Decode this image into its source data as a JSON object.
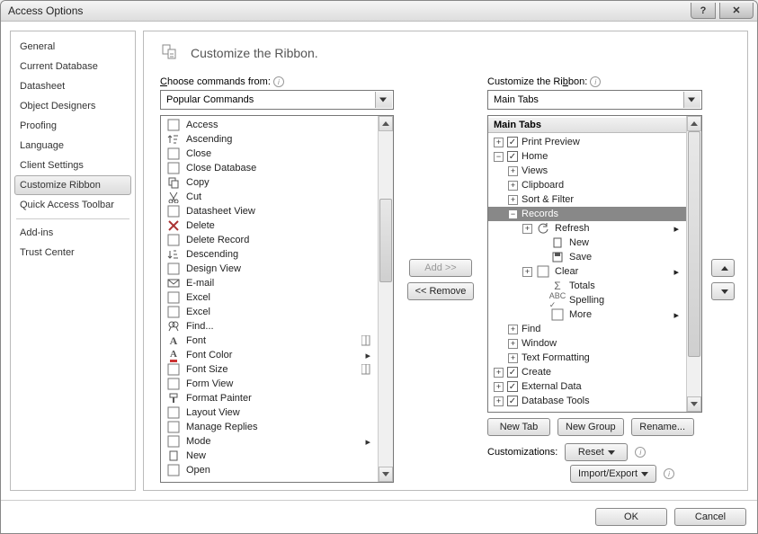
{
  "window": {
    "title": "Access Options"
  },
  "sidebar": {
    "items": [
      "General",
      "Current Database",
      "Datasheet",
      "Object Designers",
      "Proofing",
      "Language",
      "Client Settings",
      "Customize Ribbon",
      "Quick Access Toolbar",
      "Add-ins",
      "Trust Center"
    ],
    "selected_index": 7,
    "separator_before": [
      9
    ]
  },
  "header": {
    "title": "Customize the Ribbon."
  },
  "left": {
    "label_pre": "C",
    "label_rest": "hoose commands from:",
    "combo": "Popular Commands",
    "commands": [
      {
        "name": "Access",
        "icon": "access-icon"
      },
      {
        "name": "Ascending",
        "icon": "sort-asc-icon"
      },
      {
        "name": "Close",
        "icon": "close-icon"
      },
      {
        "name": "Close Database",
        "icon": "close-db-icon"
      },
      {
        "name": "Copy",
        "icon": "copy-icon"
      },
      {
        "name": "Cut",
        "icon": "cut-icon"
      },
      {
        "name": "Datasheet View",
        "icon": "datasheet-icon"
      },
      {
        "name": "Delete",
        "icon": "delete-icon"
      },
      {
        "name": "Delete Record",
        "icon": "delete-record-icon"
      },
      {
        "name": "Descending",
        "icon": "sort-desc-icon"
      },
      {
        "name": "Design View",
        "icon": "design-view-icon"
      },
      {
        "name": "E-mail",
        "icon": "email-icon"
      },
      {
        "name": "Excel",
        "icon": "excel-icon"
      },
      {
        "name": "Excel",
        "icon": "excel-icon"
      },
      {
        "name": "Find...",
        "icon": "find-icon"
      },
      {
        "name": "Font",
        "icon": "font-icon",
        "split": true
      },
      {
        "name": "Font Color",
        "icon": "font-color-icon",
        "submenu": true
      },
      {
        "name": "Font Size",
        "icon": "font-size-icon",
        "split": true
      },
      {
        "name": "Form View",
        "icon": "form-view-icon"
      },
      {
        "name": "Format Painter",
        "icon": "format-painter-icon"
      },
      {
        "name": "Layout View",
        "icon": "layout-view-icon"
      },
      {
        "name": "Manage Replies",
        "icon": "manage-replies-icon"
      },
      {
        "name": "Mode",
        "icon": "mode-icon",
        "submenu": true
      },
      {
        "name": "New",
        "icon": "new-icon"
      },
      {
        "name": "Open",
        "icon": "open-icon"
      }
    ]
  },
  "mid": {
    "add": "Add >>",
    "remove": "<< Remove"
  },
  "right": {
    "label_rest": "Customize the Ri",
    "label_post": "bbon:",
    "combo": "Main Tabs",
    "tree_header": "Main Tabs",
    "tree": [
      {
        "d": 0,
        "exp": "+",
        "chk": true,
        "label": "Print Preview"
      },
      {
        "d": 0,
        "exp": "-",
        "chk": true,
        "label": "Home"
      },
      {
        "d": 1,
        "exp": "+",
        "label": "Views"
      },
      {
        "d": 1,
        "exp": "+",
        "label": "Clipboard"
      },
      {
        "d": 1,
        "exp": "+",
        "label": "Sort & Filter"
      },
      {
        "d": 1,
        "exp": "-",
        "label": "Records",
        "selected": true
      },
      {
        "d": 2,
        "exp": "+",
        "icon": "refresh-icon",
        "label": "Refresh",
        "submenu": true
      },
      {
        "d": 3,
        "icon": "new-icon",
        "label": "New"
      },
      {
        "d": 3,
        "icon": "save-icon",
        "label": "Save"
      },
      {
        "d": 2,
        "exp": "+",
        "icon": "clear-icon",
        "label": "Clear",
        "submenu": true
      },
      {
        "d": 3,
        "icon": "totals-icon",
        "label": "Totals"
      },
      {
        "d": 3,
        "icon": "spelling-icon",
        "label": "Spelling"
      },
      {
        "d": 3,
        "icon": "more-icon",
        "label": "More",
        "submenu": true
      },
      {
        "d": 1,
        "exp": "+",
        "label": "Find"
      },
      {
        "d": 1,
        "exp": "+",
        "label": "Window"
      },
      {
        "d": 1,
        "exp": "+",
        "label": "Text Formatting"
      },
      {
        "d": 0,
        "exp": "+",
        "chk": true,
        "label": "Create"
      },
      {
        "d": 0,
        "exp": "+",
        "chk": true,
        "label": "External Data"
      },
      {
        "d": 0,
        "exp": "+",
        "chk": true,
        "label": "Database Tools"
      }
    ],
    "new_tab": "New Tab",
    "new_group": "New Group",
    "rename": "Rename...",
    "customizations": "Customizations:",
    "reset": "Reset",
    "import_export": "Import/Export"
  },
  "footer": {
    "ok": "OK",
    "cancel": "Cancel"
  }
}
